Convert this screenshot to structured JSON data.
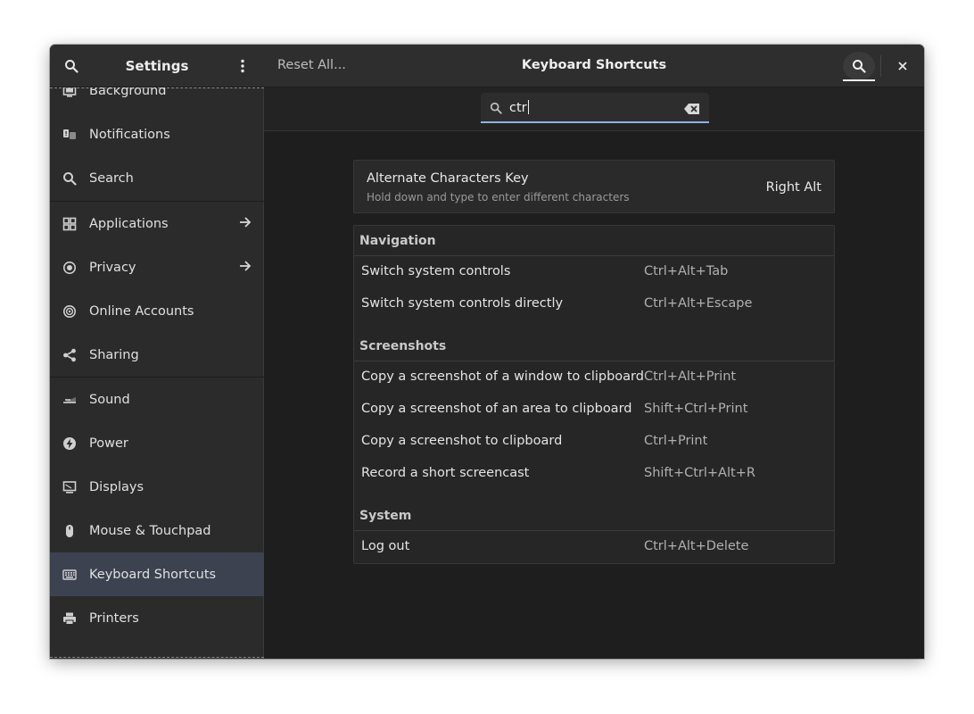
{
  "sidebar": {
    "title": "Settings",
    "items": [
      {
        "label": "Background",
        "icon": "background-icon"
      },
      {
        "label": "Notifications",
        "icon": "notifications-icon"
      },
      {
        "label": "Search",
        "icon": "search-icon"
      },
      {
        "label": "Applications",
        "icon": "applications-icon",
        "has_arrow": true
      },
      {
        "label": "Privacy",
        "icon": "privacy-icon",
        "has_arrow": true
      },
      {
        "label": "Online Accounts",
        "icon": "online-accounts-icon"
      },
      {
        "label": "Sharing",
        "icon": "sharing-icon"
      },
      {
        "label": "Sound",
        "icon": "sound-icon"
      },
      {
        "label": "Power",
        "icon": "power-icon"
      },
      {
        "label": "Displays",
        "icon": "displays-icon"
      },
      {
        "label": "Mouse & Touchpad",
        "icon": "mouse-icon"
      },
      {
        "label": "Keyboard Shortcuts",
        "icon": "keyboard-icon",
        "active": true
      },
      {
        "label": "Printers",
        "icon": "printer-icon"
      }
    ]
  },
  "header": {
    "reset_label": "Reset All...",
    "title": "Keyboard Shortcuts"
  },
  "search": {
    "value": "ctr"
  },
  "alternate": {
    "title": "Alternate Characters Key",
    "subtitle": "Hold down and type to enter different characters",
    "value": "Right Alt"
  },
  "sections": [
    {
      "title": "Navigation",
      "rows": [
        {
          "name": "Switch system controls",
          "shortcut": "Ctrl+Alt+Tab"
        },
        {
          "name": "Switch system controls directly",
          "shortcut": "Ctrl+Alt+Escape"
        }
      ]
    },
    {
      "title": "Screenshots",
      "rows": [
        {
          "name": "Copy a screenshot of a window to clipboard",
          "shortcut": "Ctrl+Alt+Print"
        },
        {
          "name": "Copy a screenshot of an area to clipboard",
          "shortcut": "Shift+Ctrl+Print"
        },
        {
          "name": "Copy a screenshot to clipboard",
          "shortcut": "Ctrl+Print"
        },
        {
          "name": "Record a short screencast",
          "shortcut": "Shift+Ctrl+Alt+R"
        }
      ]
    },
    {
      "title": "System",
      "rows": [
        {
          "name": "Log out",
          "shortcut": "Ctrl+Alt+Delete"
        }
      ]
    }
  ],
  "colors": {
    "active_row": "#3c4250",
    "focus_underline": "#8cb4e6"
  }
}
